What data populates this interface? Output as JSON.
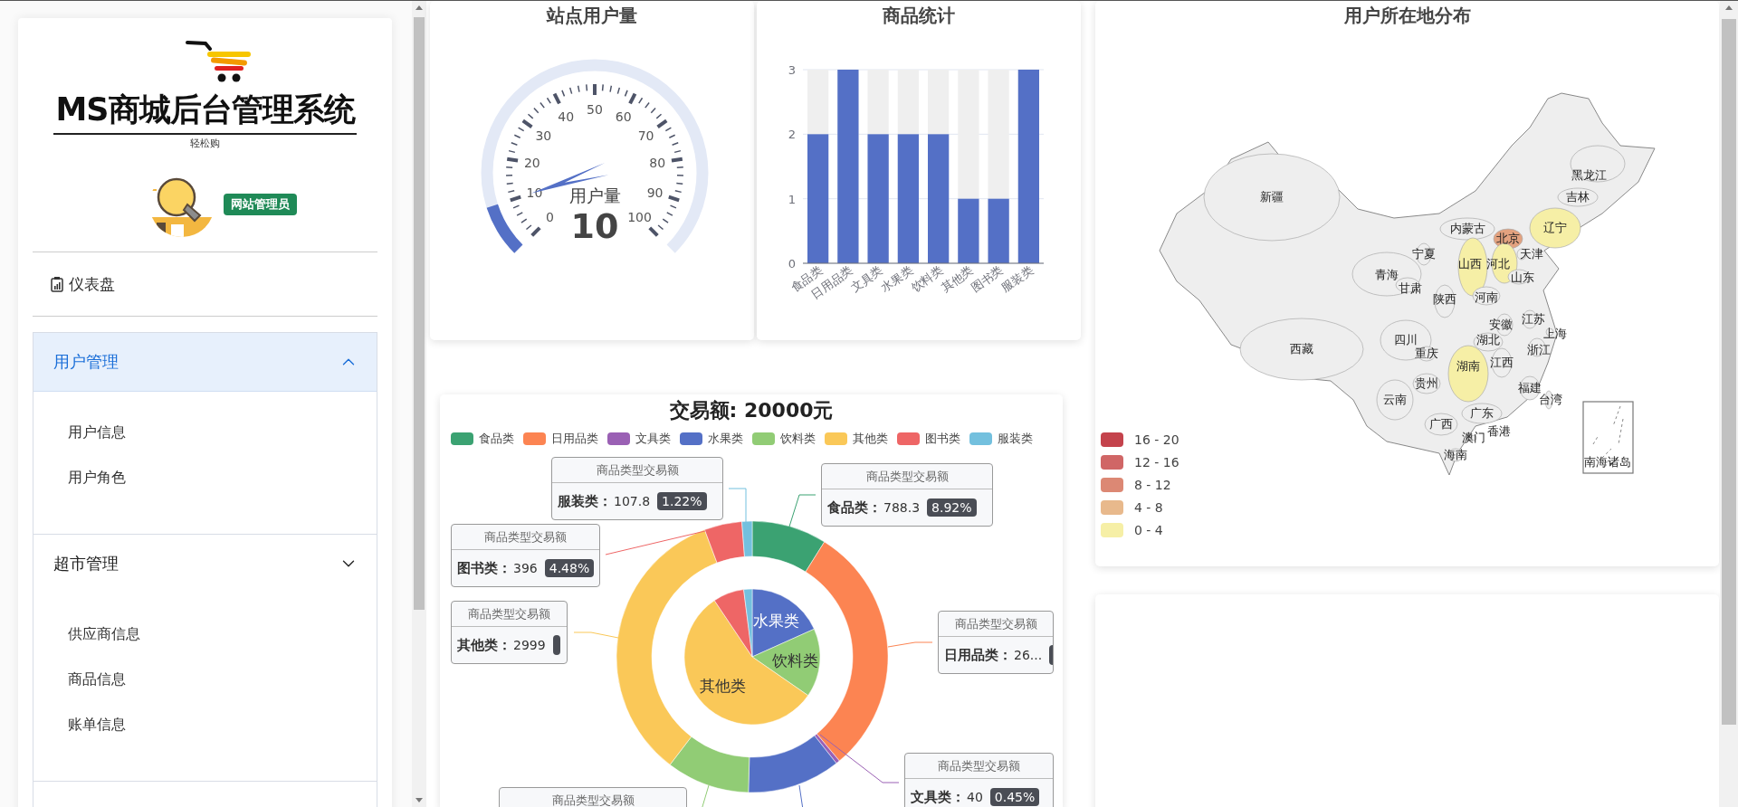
{
  "sidebar": {
    "logo_title": "MS商城后台管理系统",
    "logo_subtitle": "轻松购",
    "role_badge": "网站管理员",
    "nav": [
      {
        "kind": "link",
        "label": "仪表盘"
      },
      {
        "kind": "group",
        "label": "用户管理",
        "selected": true,
        "children": [
          {
            "label": "用户信息"
          },
          {
            "label": "用户角色"
          }
        ]
      },
      {
        "kind": "group",
        "label": "超市管理",
        "selected": false,
        "children": [
          {
            "label": "供应商信息"
          },
          {
            "label": "商品信息"
          },
          {
            "label": "账单信息"
          }
        ]
      }
    ]
  },
  "gauge": {
    "title": "站点用户量",
    "name": "用户量",
    "value": "10",
    "level": 0.1,
    "ticks": [
      "0",
      "10",
      "20",
      "30",
      "40",
      "50",
      "60",
      "70",
      "80",
      "90",
      "100"
    ]
  },
  "goods_chart": {
    "title": "商品统计",
    "chart_data": {
      "type": "bar",
      "categories": [
        "食品类",
        "日用品类",
        "文具类",
        "水果类",
        "饮料类",
        "其他类",
        "图书类",
        "服装类"
      ],
      "values": [
        2,
        3,
        2,
        2,
        2,
        1,
        1,
        3
      ],
      "ylim": [
        0,
        3
      ],
      "yticks": [
        0,
        1,
        2,
        3
      ]
    }
  },
  "map": {
    "title": "用户所在地分布",
    "provinces": [
      {
        "name": "黑龙江",
        "color": "#eeeeee"
      },
      {
        "name": "新疆",
        "color": "#eeeeee"
      },
      {
        "name": "吉林",
        "color": "#eeeeee"
      },
      {
        "name": "内蒙古",
        "color": "#eeeeee"
      },
      {
        "name": "辽宁",
        "color": "#f6efa6"
      },
      {
        "name": "北京",
        "color": "#e3a27f"
      },
      {
        "name": "宁夏",
        "color": "#eeeeee"
      },
      {
        "name": "天津",
        "color": "#eeeeee"
      },
      {
        "name": "山西",
        "color": "#f6efa6"
      },
      {
        "name": "河北",
        "color": "#f6efa6"
      },
      {
        "name": "青海",
        "color": "#eeeeee"
      },
      {
        "name": "山东",
        "color": "#eeeeee"
      },
      {
        "name": "甘肃",
        "color": "#eeeeee"
      },
      {
        "name": "陕西",
        "color": "#eeeeee"
      },
      {
        "name": "河南",
        "color": "#eeeeee"
      },
      {
        "name": "安徽",
        "color": "#eeeeee"
      },
      {
        "name": "江苏",
        "color": "#eeeeee"
      },
      {
        "name": "上海",
        "color": "#eeeeee"
      },
      {
        "name": "四川",
        "color": "#eeeeee"
      },
      {
        "name": "湖北",
        "color": "#eeeeee"
      },
      {
        "name": "西藏",
        "color": "#eeeeee"
      },
      {
        "name": "重庆",
        "color": "#eeeeee"
      },
      {
        "name": "浙江",
        "color": "#eeeeee"
      },
      {
        "name": "湖南",
        "color": "#f6efa6"
      },
      {
        "name": "江西",
        "color": "#eeeeee"
      },
      {
        "name": "贵州",
        "color": "#eeeeee"
      },
      {
        "name": "福建",
        "color": "#eeeeee"
      },
      {
        "name": "云南",
        "color": "#eeeeee"
      },
      {
        "name": "台湾",
        "color": "#eeeeee"
      },
      {
        "name": "广东",
        "color": "#eeeeee"
      },
      {
        "name": "广西",
        "color": "#eeeeee"
      },
      {
        "name": "澳门",
        "color": "#eeeeee"
      },
      {
        "name": "香港",
        "color": "#eeeeee"
      },
      {
        "name": "海南",
        "color": "#eeeeee"
      }
    ],
    "inset_label": "南海诸岛",
    "legend": [
      {
        "label": "16 - 20",
        "color": "#c4434c"
      },
      {
        "label": "12 - 16",
        "color": "#d06666"
      },
      {
        "label": "8 - 12",
        "color": "#dc8874"
      },
      {
        "label": "4 - 8",
        "color": "#e8b98c"
      },
      {
        "label": "0 - 4",
        "color": "#f6efa6"
      }
    ]
  },
  "transactions": {
    "title": "交易额: 20000元",
    "chart_data": {
      "type": "donut",
      "categories": [
        "食品类",
        "日用品类",
        "文具类",
        "水果类",
        "饮料类",
        "其他类",
        "图书类",
        "服装类"
      ],
      "series": [
        {
          "name": "商品类型交易额",
          "colors": [
            "#3ba272",
            "#fc8452",
            "#9a60b4",
            "#5470c6",
            "#91cc75",
            "#fac858",
            "#ee6666",
            "#73c0de"
          ],
          "values": [
            8.92,
            29.99,
            0.45,
            11.09,
            9.91,
            33.94,
            4.48,
            1.22
          ]
        },
        {
          "colors": [
            null,
            null,
            null,
            "#5470c6",
            "#91cc75",
            "#fac858",
            "#ee6666",
            "#73c0de"
          ],
          "values": [
            null,
            null,
            null,
            18.29,
            16.35,
            55.96,
            7.39,
            2.01
          ]
        }
      ]
    },
    "pie_labels": [
      {
        "label": "水果类"
      },
      {
        "label": "饮料类"
      },
      {
        "label": "其他类"
      }
    ],
    "callouts": [
      {
        "kind": "full",
        "name": "服装类：",
        "value": "107.8",
        "percent": "1.22%"
      },
      {
        "kind": "full",
        "name": "食品类：",
        "value": "788.3",
        "percent": "8.92%"
      },
      {
        "kind": "full",
        "name": "图书类：",
        "value": "396",
        "percent": "4.48%"
      },
      {
        "kind": "cut",
        "name": "其他类：",
        "value": "2999"
      },
      {
        "kind": "cut",
        "name": "日用品类：",
        "value": "26..."
      },
      {
        "kind": "header_only"
      },
      {
        "kind": "full",
        "name": "文具类：",
        "value": "40",
        "percent": "0.45%"
      }
    ]
  }
}
